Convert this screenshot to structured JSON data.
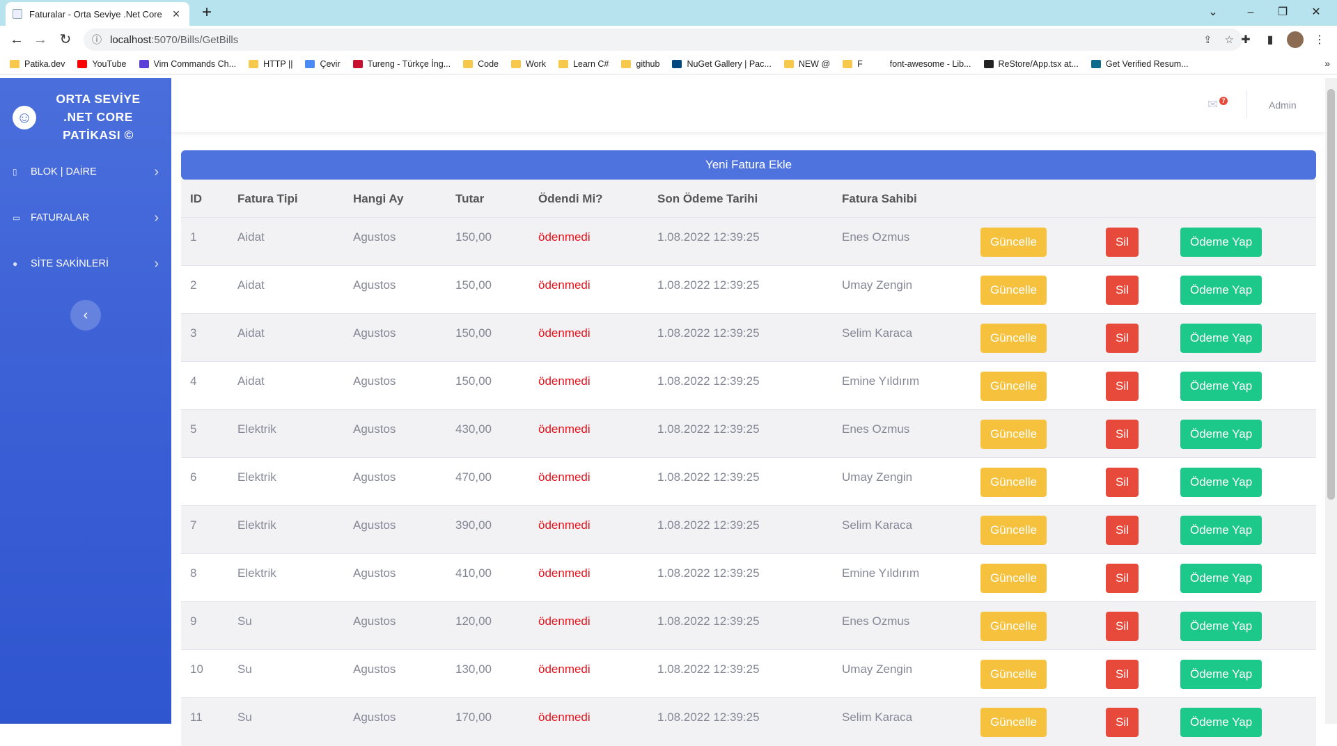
{
  "browser": {
    "tab_title": "Faturalar - Orta Seviye .Net Core",
    "url_host": "localhost",
    "url_path": ":5070/Bills/GetBills",
    "bookmarks": [
      {
        "label": "Patika.dev",
        "icon": "folder"
      },
      {
        "label": "YouTube",
        "icon": "youtube"
      },
      {
        "label": "Vim Commands Ch...",
        "icon": "vim"
      },
      {
        "label": "HTTP ||",
        "icon": "folder"
      },
      {
        "label": "Çevir",
        "icon": "translate"
      },
      {
        "label": "Tureng - Türkçe İng...",
        "icon": "tureng"
      },
      {
        "label": "Code",
        "icon": "folder"
      },
      {
        "label": "Work",
        "icon": "folder"
      },
      {
        "label": "Learn C#",
        "icon": "folder"
      },
      {
        "label": "github",
        "icon": "folder"
      },
      {
        "label": "NuGet Gallery | Pac...",
        "icon": "nuget"
      },
      {
        "label": "NEW @",
        "icon": "folder"
      },
      {
        "label": "F",
        "icon": "folder"
      },
      {
        "label": "font-awesome - Lib...",
        "icon": "code"
      },
      {
        "label": "ReStore/App.tsx at...",
        "icon": "github"
      },
      {
        "label": "Get Verified Resum...",
        "icon": "resume"
      }
    ]
  },
  "sidebar": {
    "brand": "ORTA SEVİYE .NET CORE PATİKASI ©",
    "items": [
      {
        "label": "BLOK | DAİRE",
        "icon": "square-icon"
      },
      {
        "label": "FATURALAR",
        "icon": "bill-icon"
      },
      {
        "label": "SİTE SAKİNLERİ",
        "icon": "user-icon"
      }
    ]
  },
  "topbar": {
    "mail_count": "7",
    "user": "Admin"
  },
  "main": {
    "add_button": "Yeni Fatura Ekle",
    "columns": [
      "ID",
      "Fatura Tipi",
      "Hangi Ay",
      "Tutar",
      "Ödendi Mi?",
      "Son Ödeme Tarihi",
      "Fatura Sahibi"
    ],
    "action_labels": {
      "update": "Güncelle",
      "delete": "Sil",
      "pay": "Ödeme Yap"
    },
    "rows": [
      {
        "id": "1",
        "type": "Aidat",
        "month": "Agustos",
        "amount": "150,00",
        "paid": "ödenmedi",
        "due": "1.08.2022 12:39:25",
        "owner": "Enes Ozmus"
      },
      {
        "id": "2",
        "type": "Aidat",
        "month": "Agustos",
        "amount": "150,00",
        "paid": "ödenmedi",
        "due": "1.08.2022 12:39:25",
        "owner": "Umay Zengin"
      },
      {
        "id": "3",
        "type": "Aidat",
        "month": "Agustos",
        "amount": "150,00",
        "paid": "ödenmedi",
        "due": "1.08.2022 12:39:25",
        "owner": "Selim Karaca"
      },
      {
        "id": "4",
        "type": "Aidat",
        "month": "Agustos",
        "amount": "150,00",
        "paid": "ödenmedi",
        "due": "1.08.2022 12:39:25",
        "owner": "Emine Yıldırım"
      },
      {
        "id": "5",
        "type": "Elektrik",
        "month": "Agustos",
        "amount": "430,00",
        "paid": "ödenmedi",
        "due": "1.08.2022 12:39:25",
        "owner": "Enes Ozmus"
      },
      {
        "id": "6",
        "type": "Elektrik",
        "month": "Agustos",
        "amount": "470,00",
        "paid": "ödenmedi",
        "due": "1.08.2022 12:39:25",
        "owner": "Umay Zengin"
      },
      {
        "id": "7",
        "type": "Elektrik",
        "month": "Agustos",
        "amount": "390,00",
        "paid": "ödenmedi",
        "due": "1.08.2022 12:39:25",
        "owner": "Selim Karaca"
      },
      {
        "id": "8",
        "type": "Elektrik",
        "month": "Agustos",
        "amount": "410,00",
        "paid": "ödenmedi",
        "due": "1.08.2022 12:39:25",
        "owner": "Emine Yıldırım"
      },
      {
        "id": "9",
        "type": "Su",
        "month": "Agustos",
        "amount": "120,00",
        "paid": "ödenmedi",
        "due": "1.08.2022 12:39:25",
        "owner": "Enes Ozmus"
      },
      {
        "id": "10",
        "type": "Su",
        "month": "Agustos",
        "amount": "130,00",
        "paid": "ödenmedi",
        "due": "1.08.2022 12:39:25",
        "owner": "Umay Zengin"
      },
      {
        "id": "11",
        "type": "Su",
        "month": "Agustos",
        "amount": "170,00",
        "paid": "ödenmedi",
        "due": "1.08.2022 12:39:25",
        "owner": "Selim Karaca"
      }
    ]
  },
  "colors": {
    "primary": "#4e73df",
    "warning": "#f6c23e",
    "danger": "#e74a3b",
    "success": "#1cc88a",
    "unpaid_text": "#e6131d"
  }
}
